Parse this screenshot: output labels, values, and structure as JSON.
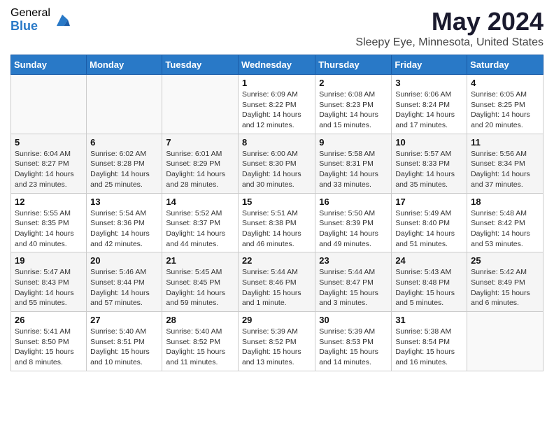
{
  "header": {
    "logo_general": "General",
    "logo_blue": "Blue",
    "title": "May 2024",
    "subtitle": "Sleepy Eye, Minnesota, United States"
  },
  "weekdays": [
    "Sunday",
    "Monday",
    "Tuesday",
    "Wednesday",
    "Thursday",
    "Friday",
    "Saturday"
  ],
  "weeks": [
    [
      {
        "day": "",
        "info": ""
      },
      {
        "day": "",
        "info": ""
      },
      {
        "day": "",
        "info": ""
      },
      {
        "day": "1",
        "info": "Sunrise: 6:09 AM\nSunset: 8:22 PM\nDaylight: 14 hours and 12 minutes."
      },
      {
        "day": "2",
        "info": "Sunrise: 6:08 AM\nSunset: 8:23 PM\nDaylight: 14 hours and 15 minutes."
      },
      {
        "day": "3",
        "info": "Sunrise: 6:06 AM\nSunset: 8:24 PM\nDaylight: 14 hours and 17 minutes."
      },
      {
        "day": "4",
        "info": "Sunrise: 6:05 AM\nSunset: 8:25 PM\nDaylight: 14 hours and 20 minutes."
      }
    ],
    [
      {
        "day": "5",
        "info": "Sunrise: 6:04 AM\nSunset: 8:27 PM\nDaylight: 14 hours and 23 minutes."
      },
      {
        "day": "6",
        "info": "Sunrise: 6:02 AM\nSunset: 8:28 PM\nDaylight: 14 hours and 25 minutes."
      },
      {
        "day": "7",
        "info": "Sunrise: 6:01 AM\nSunset: 8:29 PM\nDaylight: 14 hours and 28 minutes."
      },
      {
        "day": "8",
        "info": "Sunrise: 6:00 AM\nSunset: 8:30 PM\nDaylight: 14 hours and 30 minutes."
      },
      {
        "day": "9",
        "info": "Sunrise: 5:58 AM\nSunset: 8:31 PM\nDaylight: 14 hours and 33 minutes."
      },
      {
        "day": "10",
        "info": "Sunrise: 5:57 AM\nSunset: 8:33 PM\nDaylight: 14 hours and 35 minutes."
      },
      {
        "day": "11",
        "info": "Sunrise: 5:56 AM\nSunset: 8:34 PM\nDaylight: 14 hours and 37 minutes."
      }
    ],
    [
      {
        "day": "12",
        "info": "Sunrise: 5:55 AM\nSunset: 8:35 PM\nDaylight: 14 hours and 40 minutes."
      },
      {
        "day": "13",
        "info": "Sunrise: 5:54 AM\nSunset: 8:36 PM\nDaylight: 14 hours and 42 minutes."
      },
      {
        "day": "14",
        "info": "Sunrise: 5:52 AM\nSunset: 8:37 PM\nDaylight: 14 hours and 44 minutes."
      },
      {
        "day": "15",
        "info": "Sunrise: 5:51 AM\nSunset: 8:38 PM\nDaylight: 14 hours and 46 minutes."
      },
      {
        "day": "16",
        "info": "Sunrise: 5:50 AM\nSunset: 8:39 PM\nDaylight: 14 hours and 49 minutes."
      },
      {
        "day": "17",
        "info": "Sunrise: 5:49 AM\nSunset: 8:40 PM\nDaylight: 14 hours and 51 minutes."
      },
      {
        "day": "18",
        "info": "Sunrise: 5:48 AM\nSunset: 8:42 PM\nDaylight: 14 hours and 53 minutes."
      }
    ],
    [
      {
        "day": "19",
        "info": "Sunrise: 5:47 AM\nSunset: 8:43 PM\nDaylight: 14 hours and 55 minutes."
      },
      {
        "day": "20",
        "info": "Sunrise: 5:46 AM\nSunset: 8:44 PM\nDaylight: 14 hours and 57 minutes."
      },
      {
        "day": "21",
        "info": "Sunrise: 5:45 AM\nSunset: 8:45 PM\nDaylight: 14 hours and 59 minutes."
      },
      {
        "day": "22",
        "info": "Sunrise: 5:44 AM\nSunset: 8:46 PM\nDaylight: 15 hours and 1 minute."
      },
      {
        "day": "23",
        "info": "Sunrise: 5:44 AM\nSunset: 8:47 PM\nDaylight: 15 hours and 3 minutes."
      },
      {
        "day": "24",
        "info": "Sunrise: 5:43 AM\nSunset: 8:48 PM\nDaylight: 15 hours and 5 minutes."
      },
      {
        "day": "25",
        "info": "Sunrise: 5:42 AM\nSunset: 8:49 PM\nDaylight: 15 hours and 6 minutes."
      }
    ],
    [
      {
        "day": "26",
        "info": "Sunrise: 5:41 AM\nSunset: 8:50 PM\nDaylight: 15 hours and 8 minutes."
      },
      {
        "day": "27",
        "info": "Sunrise: 5:40 AM\nSunset: 8:51 PM\nDaylight: 15 hours and 10 minutes."
      },
      {
        "day": "28",
        "info": "Sunrise: 5:40 AM\nSunset: 8:52 PM\nDaylight: 15 hours and 11 minutes."
      },
      {
        "day": "29",
        "info": "Sunrise: 5:39 AM\nSunset: 8:52 PM\nDaylight: 15 hours and 13 minutes."
      },
      {
        "day": "30",
        "info": "Sunrise: 5:39 AM\nSunset: 8:53 PM\nDaylight: 15 hours and 14 minutes."
      },
      {
        "day": "31",
        "info": "Sunrise: 5:38 AM\nSunset: 8:54 PM\nDaylight: 15 hours and 16 minutes."
      },
      {
        "day": "",
        "info": ""
      }
    ]
  ]
}
